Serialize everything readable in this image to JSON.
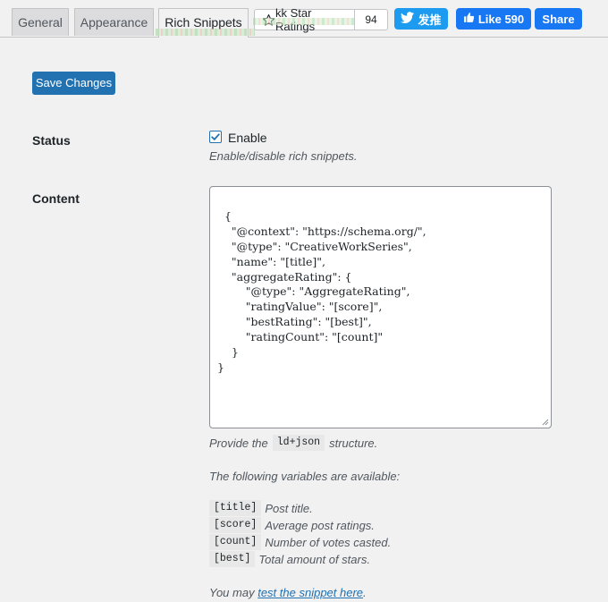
{
  "tabs": [
    {
      "label": "General"
    },
    {
      "label": "Appearance"
    },
    {
      "label": "Rich Snippets"
    }
  ],
  "rating_widget": {
    "label": "kk Star Ratings",
    "count": "94"
  },
  "social": {
    "tweet_label": "发推",
    "like_label": "Like 590",
    "share_label": "Share"
  },
  "save_label": "Save Changes",
  "status": {
    "label": "Status",
    "checkbox_label": "Enable",
    "checked": true,
    "description": "Enable/disable rich snippets."
  },
  "content": {
    "label": "Content",
    "json_text": "{\n    \"@context\": \"https://schema.org/\",\n    \"@type\": \"CreativeWorkSeries\",\n    \"name\": \"[title]\",\n    \"aggregateRating\": {\n        \"@type\": \"AggregateRating\",\n        \"ratingValue\": \"[score]\",\n        \"bestRating\": \"[best]\",\n        \"ratingCount\": \"[count]\"\n    }\n}",
    "hint_prefix": "Provide the",
    "hint_code": "ld+json",
    "hint_suffix": "structure.",
    "vars_intro": "The following variables are available:",
    "variables": [
      {
        "code": "[title]",
        "desc": "Post title."
      },
      {
        "code": "[score]",
        "desc": "Average post ratings."
      },
      {
        "code": "[count]",
        "desc": "Number of votes casted."
      },
      {
        "code": "[best]",
        "desc": "Total amount of stars."
      }
    ],
    "test_prefix": "You may",
    "test_link": "test the snippet here",
    "test_suffix": "."
  },
  "colors": {
    "accent": "#2271b1",
    "twitter": "#1d9bf0",
    "facebook": "#1877f2"
  }
}
